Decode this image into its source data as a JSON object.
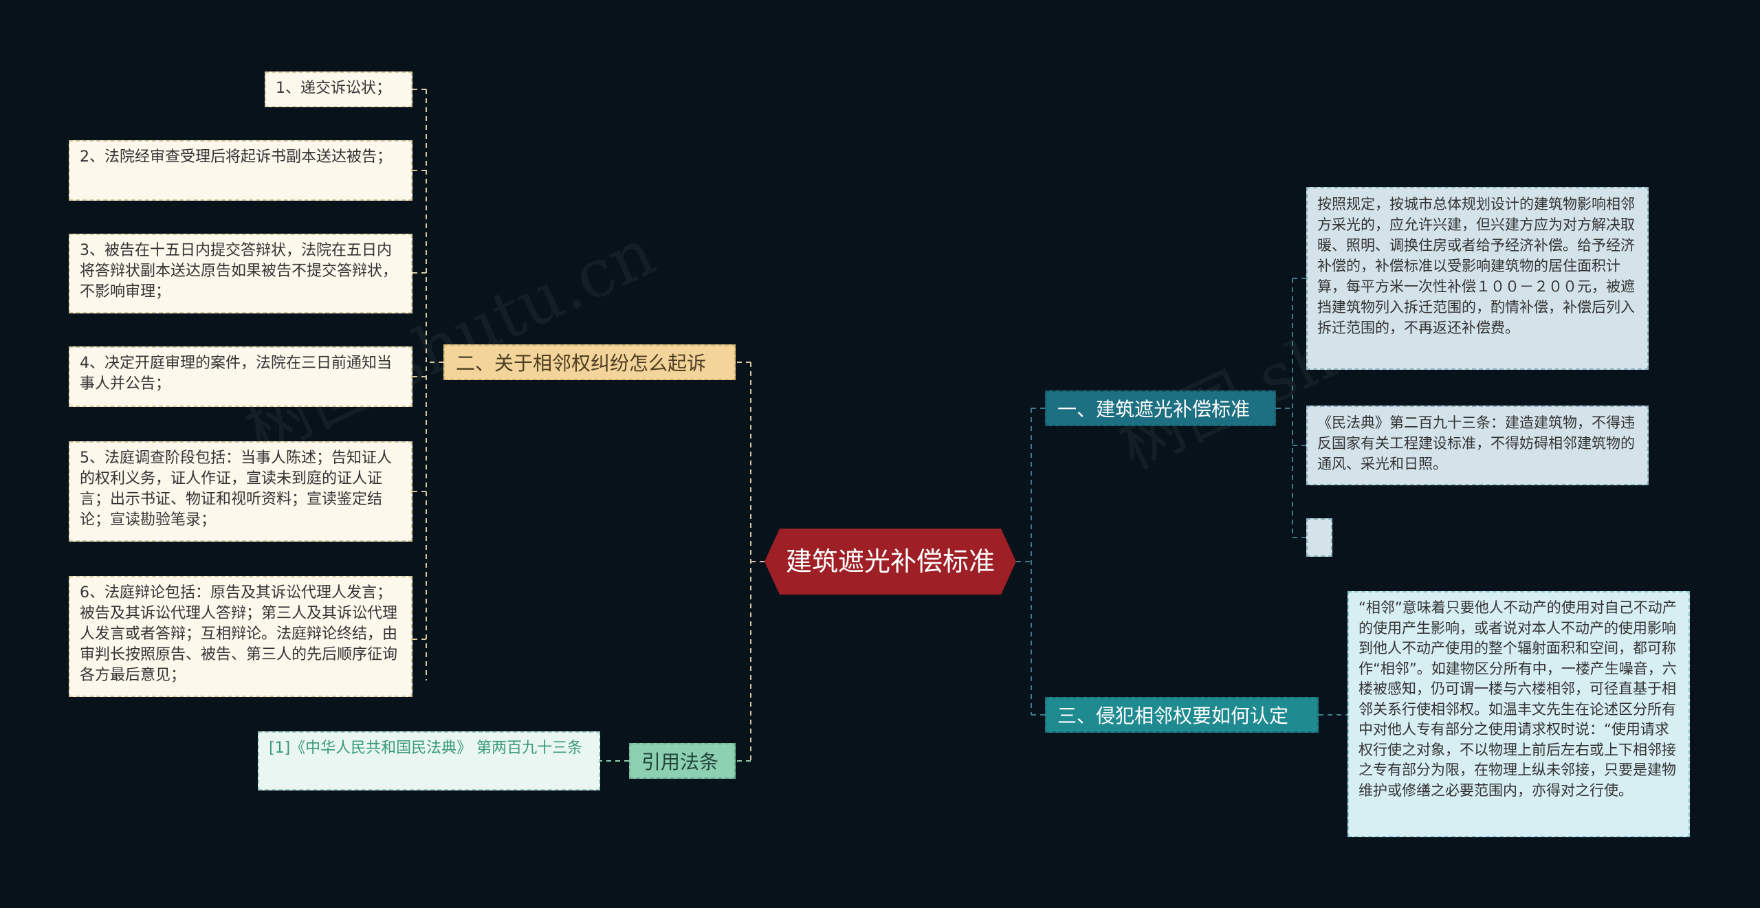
{
  "center": {
    "label": "建筑遮光补偿标准",
    "color": "#9e1f25"
  },
  "left": {
    "branch_sue": {
      "label": "二、关于相邻权纠纷怎么起诉",
      "steps": [
        "1、递交诉讼状；",
        "2、法院经审查受理后将起诉书副本送达被告；",
        "3、被告在十五日内提交答辩状，法院在五日内将答辩状副本送达原告如果被告不提交答辩状，不影响审理；",
        "4、决定开庭审理的案件，法院在三日前通知当事人并公告；",
        "5、法庭调查阶段包括：当事人陈述；告知证人的权利义务，证人作证，宣读未到庭的证人证言；出示书证、物证和视听资料；宣读鉴定结论；宣读勘验笔录；",
        "6、法庭辩论包括：原告及其诉讼代理人发言；被告及其诉讼代理人答辩；第三人及其诉讼代理人发言或者答辩；互相辩论。法庭辩论终结，由审判长按照原告、被告、第三人的先后顺序征询各方最后意见；"
      ]
    },
    "branch_cite": {
      "label": "引用法条",
      "citation": "[1]《中华人民共和国民法典》 第两百九十三条"
    }
  },
  "right": {
    "branch_standard": {
      "label": "一、建筑遮光补偿标准",
      "notes": [
        "按照规定，按城市总体规划设计的建筑物影响相邻方采光的，应允许兴建，但兴建方应为对方解决取暖、照明、调换住房或者给予经济补偿。给予经济补偿的，补偿标准以受影响建筑物的居住面积计算，每平方米一次性补偿１００－２００元，被遮挡建筑物列入拆迁范围的，酌情补偿，补偿后列入拆迁范围的，不再返还补偿费。",
        "《民法典》第二百九十三条：建造建筑物，不得违反国家有关工程建设标准，不得妨碍相邻建筑物的通风、采光和日照。",
        ""
      ]
    },
    "branch_infringe": {
      "label": "三、侵犯相邻权要如何认定",
      "note": "“相邻”意味着只要他人不动产的使用对自己不动产的使用产生影响，或者说对本人不动产的使用影响到他人不动产使用的整个辐射面积和空间，都可称作“相邻”。如建物区分所有中，一楼产生噪音，六楼被感知，仍可谓一楼与六楼相邻，可径直基于相邻关系行使相邻权。如温丰文先生在论述区分所有中对他人专有部分之使用请求权时说：“使用请求权行使之对象，不以物理上前后左右或上下相邻接之专有部分为限，在物理上纵未邻接，只要是建物维护或修缮之必要范围内，亦得对之行使。"
    }
  },
  "colors": {
    "background": "#07121a",
    "left_link": "#d8c9a0",
    "right_link": "#3c7d8a",
    "cite_link": "#8dd0b2"
  },
  "watermark": {
    "text": "树图 shutu.cn"
  }
}
